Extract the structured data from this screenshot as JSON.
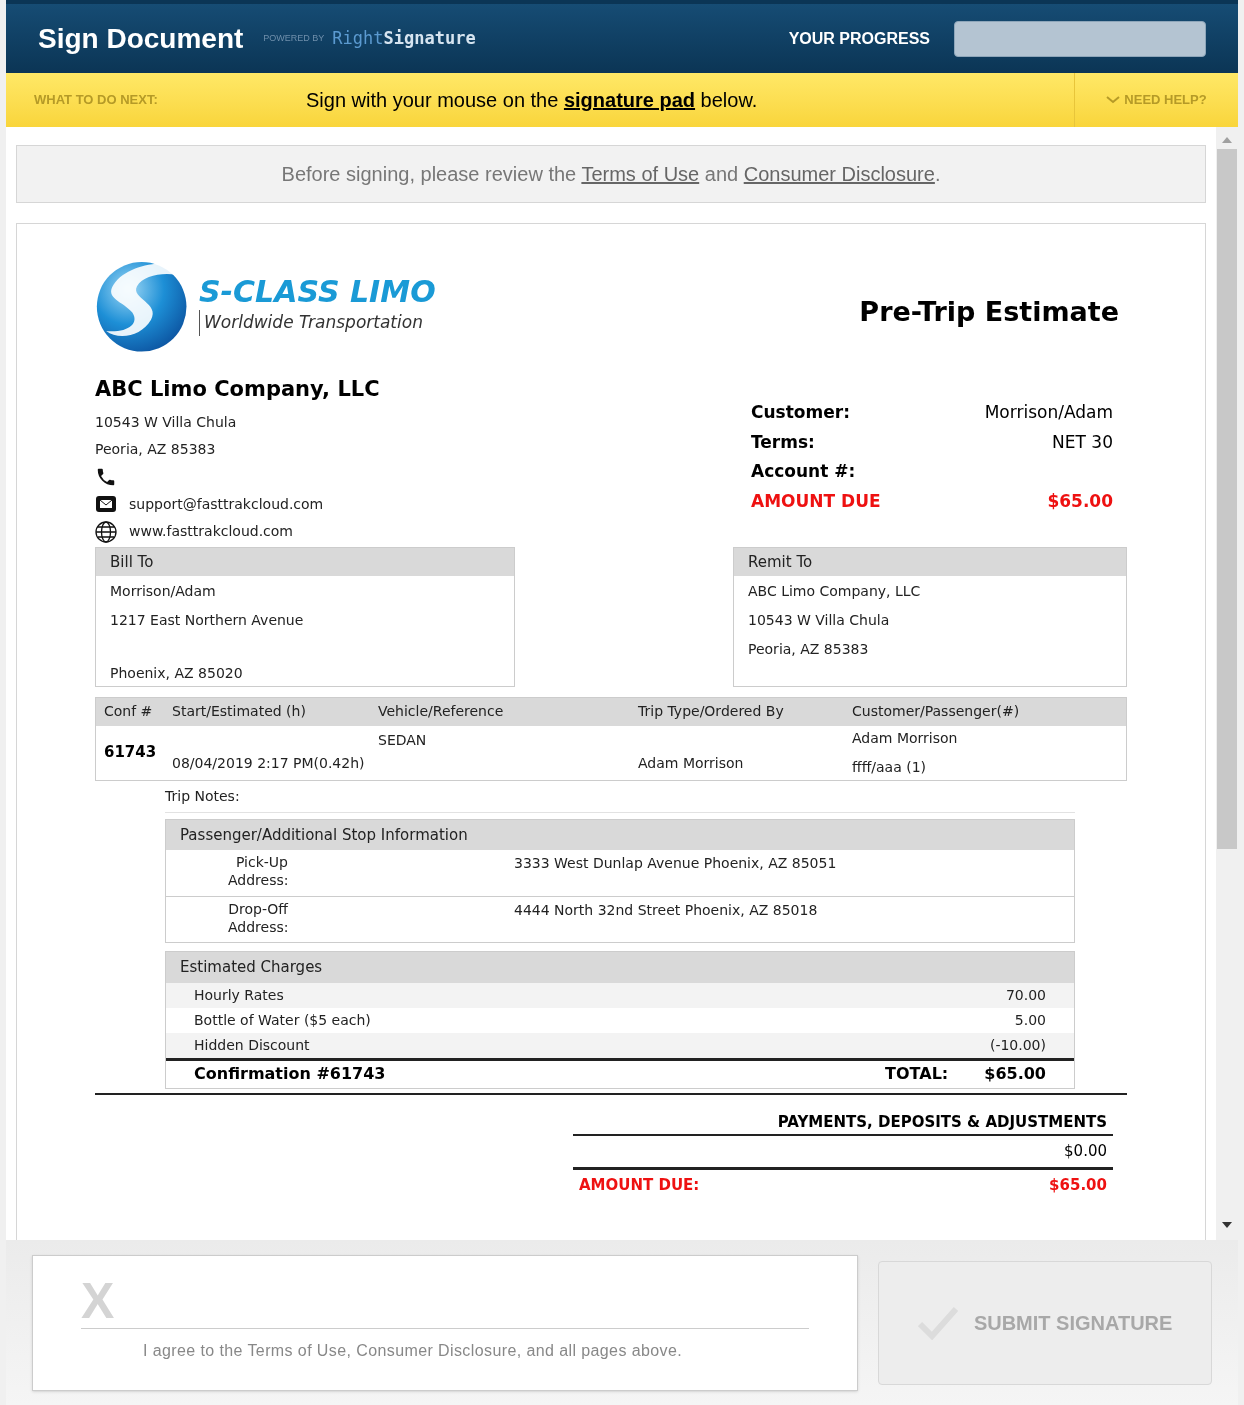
{
  "header": {
    "title": "Sign Document",
    "powered_by": "POWERED BY",
    "brand_light": "Right",
    "brand_bold": "Signature",
    "progress_label": "YOUR PROGRESS",
    "progress": {
      "level": 0
    }
  },
  "instruction_bar": {
    "label": "WHAT TO DO NEXT:",
    "message": "Sign with your mouse on the **signature pad** below.",
    "help": "NEED HELP?"
  },
  "notice": {
    "before": "Before signing, please review the",
    "links": [
      "Terms of Use",
      "Consumer Disclosure"
    ],
    "joiner": "and",
    "end": "."
  },
  "document": {
    "logo": {
      "name": "S-CLASS LIMO",
      "tagline": "Worldwide Transportation"
    },
    "title": "Pre-Trip Estimate",
    "company": {
      "name": "ABC Limo Company, LLC",
      "address_lines": [
        "10543 W Villa Chula",
        "Peoria, AZ 85383"
      ],
      "email": "support@fasttrakcloud.com",
      "website": "www.fasttrakcloud.com"
    },
    "summary": [
      {
        "label": "Customer:",
        "value": "Morrison/Adam",
        "kind": "normal"
      },
      {
        "label": "Terms:",
        "value": "NET 30",
        "kind": "normal"
      },
      {
        "label": "Account #:",
        "kind": "normal"
      },
      {
        "label": "AMOUNT DUE",
        "value": "$65.00",
        "kind": "due"
      }
    ],
    "bill_to": {
      "heading": "Bill To",
      "name": "Morrison/Adam",
      "street": "1217 East Northern Avenue",
      "city": "Phoenix, AZ 85020"
    },
    "remit_to": {
      "heading": "Remit To",
      "lines": [
        "ABC Limo Company, LLC",
        "10543 W Villa Chula",
        "Peoria, AZ 85383"
      ]
    },
    "trip_table": {
      "columns": [
        "Conf #",
        "Start/Estimated (h)",
        "Vehicle/Reference",
        "Trip Type/Ordered By",
        "Customer/Passenger(#)"
      ],
      "row": {
        "conf": "61743",
        "start": "08/04/2019 2:17 PM(0.42h)",
        "vehicle": "SEDAN",
        "ordered_by": "Adam Morrison",
        "customer": "Adam Morrison",
        "passenger": "ffff/aaa (1)"
      }
    },
    "trip_notes": "Trip Notes:",
    "stops": {
      "heading": "Passenger/Additional Stop Information",
      "rows": [
        {
          "label": "Pick-Up Address:",
          "value": "3333 West Dunlap Avenue Phoenix, AZ 85051"
        },
        {
          "label": "Drop-Off Address:",
          "value": "4444 North 32nd Street Phoenix, AZ 85018"
        }
      ]
    },
    "charges": {
      "heading": "Estimated Charges",
      "items": [
        {
          "label": "Hourly Rates",
          "amount": "70.00"
        },
        {
          "label": "Bottle of Water ($5 each)",
          "amount": "5.00"
        },
        {
          "label": "Hidden Discount",
          "amount": "(-10.00)"
        }
      ],
      "confirmation": "Confirmation #61743",
      "total_label": "TOTAL:",
      "total": "$65.00"
    },
    "payments": {
      "heading": "PAYMENTS, DEPOSITS & ADJUSTMENTS",
      "amount": "$0.00",
      "due_label": "AMOUNT DUE:",
      "due_value": "$65.00"
    }
  },
  "signature_pad": {
    "mark": "X",
    "agreement": "I agree to the Terms of Use, Consumer Disclosure, and all pages above."
  },
  "submit": {
    "label": "SUBMIT SIGNATURE",
    "disabled": true
  }
}
